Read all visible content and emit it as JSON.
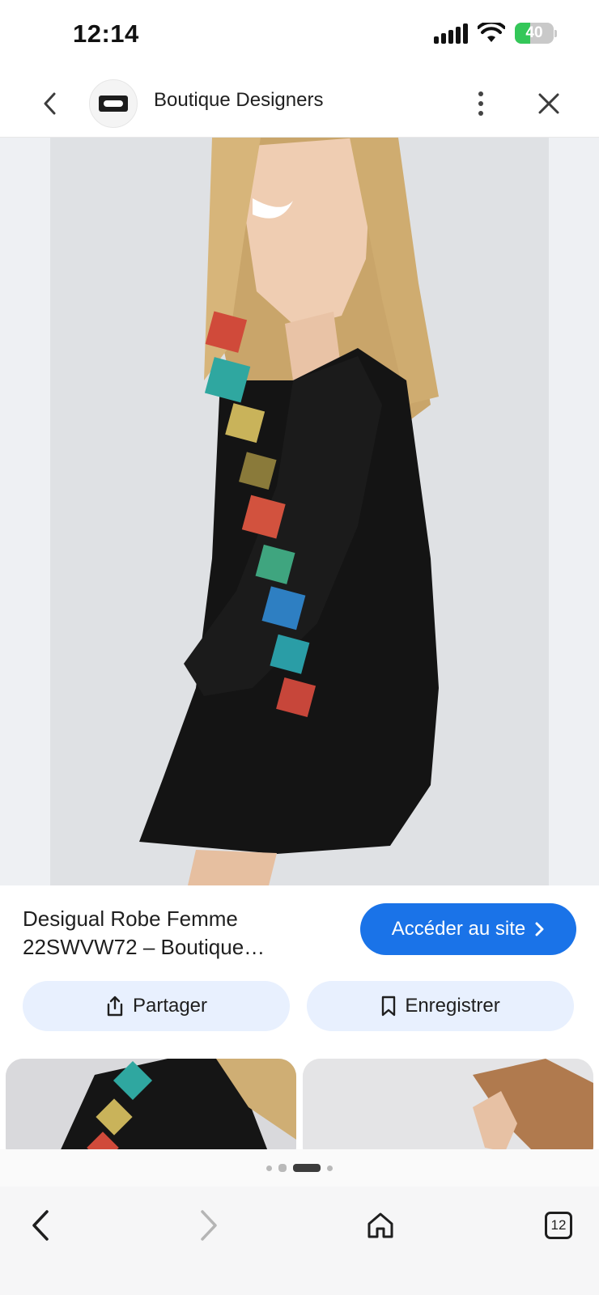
{
  "status_bar": {
    "time": "12:14",
    "battery_text": "40",
    "battery_level": 0.4,
    "icons": [
      "signal-icon",
      "wifi-icon",
      "battery-icon"
    ]
  },
  "header": {
    "site_name": "Boutique Designers",
    "icons": [
      "chevron-left-icon",
      "site-logo",
      "more-vert-icon",
      "close-icon"
    ]
  },
  "product": {
    "title": "Desigual Robe Femme 22SWVW72 – Boutique…",
    "visit_label": "Accéder au site",
    "visit_icon": "chevron-right-icon"
  },
  "actions": {
    "share_label": "Partager",
    "share_icon": "share-icon",
    "save_label": "Enregistrer",
    "save_icon": "bookmark-icon"
  },
  "pager": {
    "count": 4,
    "active_index": 2
  },
  "toolbar": {
    "tabs_count": "12",
    "icons": [
      "back-icon",
      "forward-icon",
      "home-icon",
      "tabs-icon"
    ]
  },
  "colors": {
    "accent": "#1a73e8",
    "button_bg": "#e8f0fe",
    "battery": "#34c759"
  }
}
